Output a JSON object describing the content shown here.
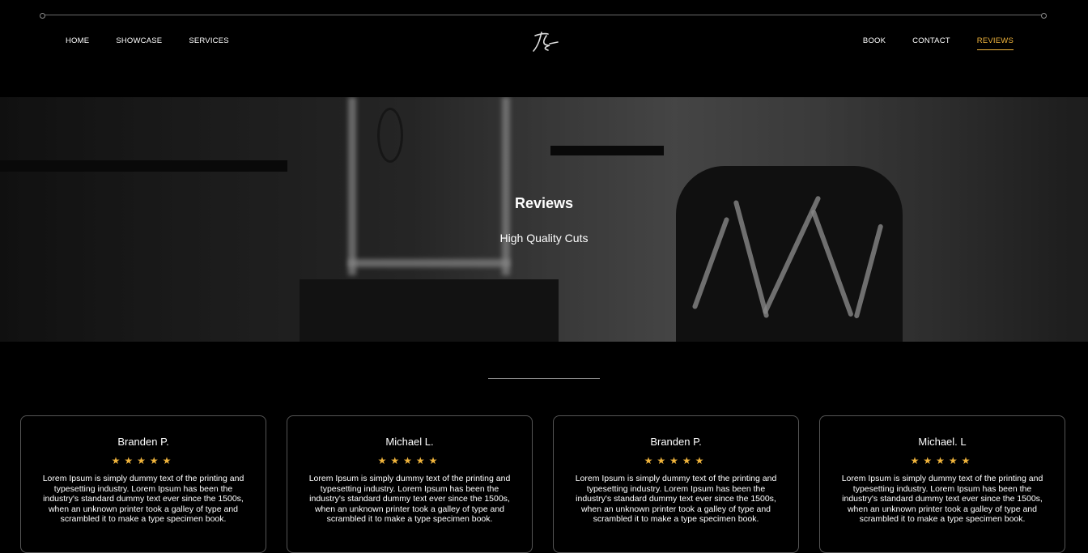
{
  "nav": {
    "left": [
      "HOME",
      "SHOWCASE",
      "SERVICES"
    ],
    "right": [
      "BOOK",
      "CONTACT",
      "REVIEWS"
    ],
    "active": "REVIEWS",
    "logo_text": "JZ"
  },
  "hero": {
    "title": "Reviews",
    "subtitle": "High Quality Cuts"
  },
  "reviews": [
    {
      "name": "Branden P.",
      "stars": "★★★★★",
      "text": "Lorem Ipsum is simply dummy text of the printing and typesetting industry. Lorem Ipsum has been the industry's standard dummy text ever since the 1500s, when an unknown printer took a galley of type and scrambled it to make a type specimen book."
    },
    {
      "name": "Michael L.",
      "stars": "★★★★★",
      "text": "Lorem Ipsum is simply dummy text of the printing and typesetting industry. Lorem Ipsum has been the industry's standard dummy text ever since the 1500s, when an unknown printer took a galley of type and scrambled it to make a type specimen book."
    },
    {
      "name": "Branden P.",
      "stars": "★★★★★",
      "text": "Lorem Ipsum is simply dummy text of the printing and typesetting industry. Lorem Ipsum has been the industry's standard dummy text ever since the 1500s, when an unknown printer took a galley of type and scrambled it to make a type specimen book."
    },
    {
      "name": "Michael. L",
      "stars": "★★★★★",
      "text": "Lorem Ipsum is simply dummy text of the printing and typesetting industry. Lorem Ipsum has been the industry's standard dummy text ever since the 1500s, when an unknown printer took a galley of type and scrambled it to make a type specimen book."
    }
  ],
  "colors": {
    "background": "#000000",
    "accent": "#f0b43c",
    "card_border": "#555555"
  }
}
